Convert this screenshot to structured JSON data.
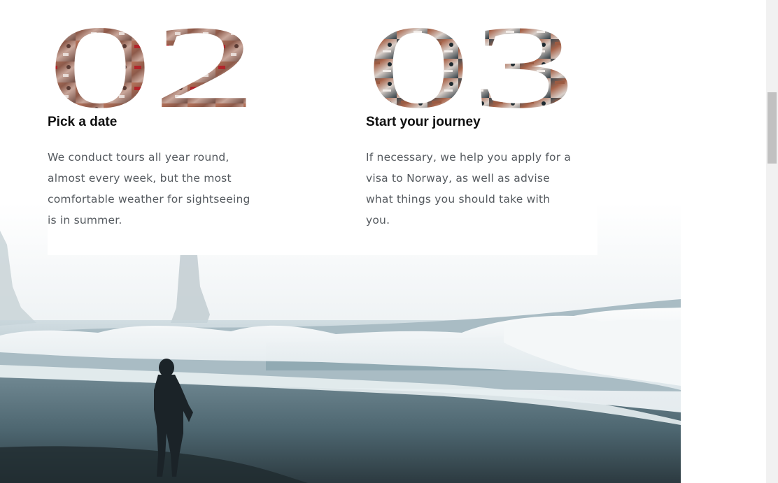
{
  "steps": [
    {
      "number": "02",
      "title": "Pick a date",
      "text": "We conduct tours all year round, almost every week, but the most comfortable weather for sightseeing is in summer."
    },
    {
      "number": "03",
      "title": "Start your journey",
      "text": "If necessary, we help you apply for a visa to Norway, as well as advise what things you should take with you."
    }
  ]
}
